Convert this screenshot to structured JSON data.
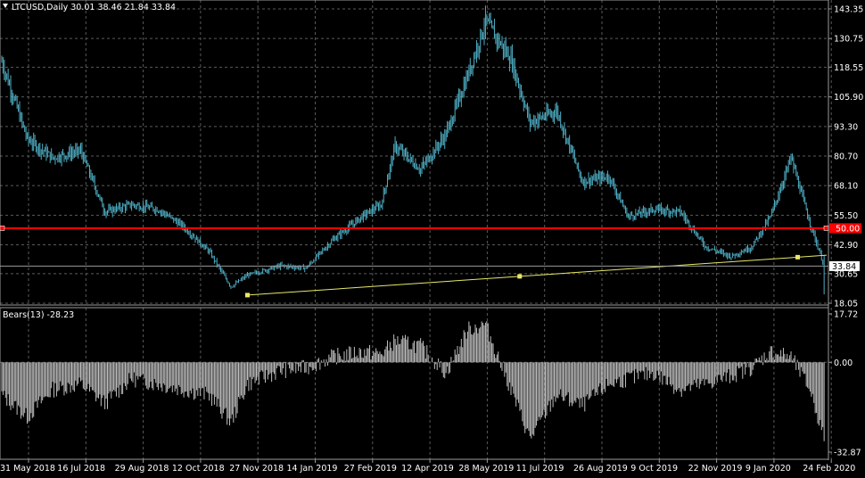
{
  "main_title": "LTCUSD,Daily  30.01 38.46 21.84 33.84",
  "ind_title": "Bears(13) -28.23",
  "colors": {
    "background": "#000000",
    "grid": "#5a5a5a",
    "price_bars": "#4fb0c6",
    "indicator_bars": "#c0c0c0",
    "hline": "#ff0000",
    "trendline": "#e8e86a",
    "axis_text": "#ffffff"
  },
  "price_axis_labels": [
    "143.35",
    "130.75",
    "118.55",
    "105.90",
    "93.30",
    "80.70",
    "68.10",
    "55.50",
    "42.90",
    "30.65",
    "18.05"
  ],
  "indicator_axis_labels": [
    "17.72",
    "0.00",
    "-32.87"
  ],
  "hline_label": "50.00",
  "current_price_label": "33.84",
  "time_labels": [
    "31 May 2018",
    "16 Jul 2018",
    "29 Aug 2018",
    "12 Oct 2018",
    "27 Nov 2018",
    "14 Jan 2019",
    "27 Feb 2019",
    "12 Apr 2019",
    "28 May 2019",
    "11 Jul 2019",
    "26 Aug 2019",
    "9 Oct 2019",
    "22 Nov 2019",
    "9 Jan 2020",
    "24 Feb 2020"
  ],
  "chart_data": [
    {
      "type": "line",
      "title": "LTCUSD,Daily  30.01 38.46 21.84 33.84",
      "ohlc_last": {
        "open": 30.01,
        "high": 38.46,
        "low": 21.84,
        "close": 33.84
      },
      "x": [
        "2018-05-31",
        "2018-06-20",
        "2018-07-10",
        "2018-08-01",
        "2018-08-20",
        "2018-09-10",
        "2018-10-01",
        "2018-10-20",
        "2018-11-10",
        "2018-11-27",
        "2018-12-10",
        "2019-01-05",
        "2019-01-25",
        "2019-02-15",
        "2019-03-10",
        "2019-03-25",
        "2019-04-05",
        "2019-04-25",
        "2019-05-15",
        "2019-06-01",
        "2019-06-15",
        "2019-07-05",
        "2019-07-20",
        "2019-08-10",
        "2019-08-30",
        "2019-09-20",
        "2019-10-05",
        "2019-10-25",
        "2019-11-15",
        "2019-12-05",
        "2019-12-25",
        "2020-01-10",
        "2020-01-25",
        "2020-02-10",
        "2020-02-25",
        "2020-03-07"
      ],
      "series": [
        {
          "values": [
            121,
            88,
            80,
            83,
            57,
            60,
            58,
            51,
            40,
            25,
            30,
            34,
            33,
            45,
            55,
            60,
            85,
            75,
            90,
            115,
            138,
            122,
            95,
            100,
            70,
            72,
            55,
            58,
            57,
            42,
            38,
            42,
            55,
            80,
            52,
            34
          ]
        }
      ],
      "ylim": [
        18.05,
        143.35
      ],
      "hline": 50.0,
      "trendline": {
        "from": {
          "x": "2018-12-10",
          "y": 21.5
        },
        "to": {
          "x": "2020-03-09",
          "y": 38.5
        }
      }
    },
    {
      "type": "bar",
      "title": "Bears(13) -28.23",
      "x": [
        "2018-05-31",
        "2018-06-20",
        "2018-07-10",
        "2018-08-01",
        "2018-08-20",
        "2018-09-10",
        "2018-10-01",
        "2018-10-20",
        "2018-11-10",
        "2018-11-27",
        "2018-12-10",
        "2019-01-05",
        "2019-01-25",
        "2019-02-15",
        "2019-03-10",
        "2019-03-25",
        "2019-04-05",
        "2019-04-25",
        "2019-05-15",
        "2019-06-01",
        "2019-06-15",
        "2019-07-05",
        "2019-07-20",
        "2019-08-10",
        "2019-08-30",
        "2019-09-20",
        "2019-10-05",
        "2019-10-25",
        "2019-11-15",
        "2019-12-05",
        "2019-12-25",
        "2020-01-10",
        "2020-01-25",
        "2020-02-10",
        "2020-02-25",
        "2020-03-07"
      ],
      "values": [
        -12,
        -20,
        -10,
        -8,
        -15,
        -6,
        -8,
        -10,
        -12,
        -22,
        -8,
        -3,
        -2,
        2,
        4,
        3,
        8,
        6,
        -4,
        12,
        14,
        -10,
        -28,
        -12,
        -16,
        -8,
        -6,
        -4,
        -10,
        -8,
        -5,
        -2,
        4,
        2,
        -10,
        -28
      ],
      "ylim": [
        -32.87,
        17.72
      ]
    }
  ]
}
